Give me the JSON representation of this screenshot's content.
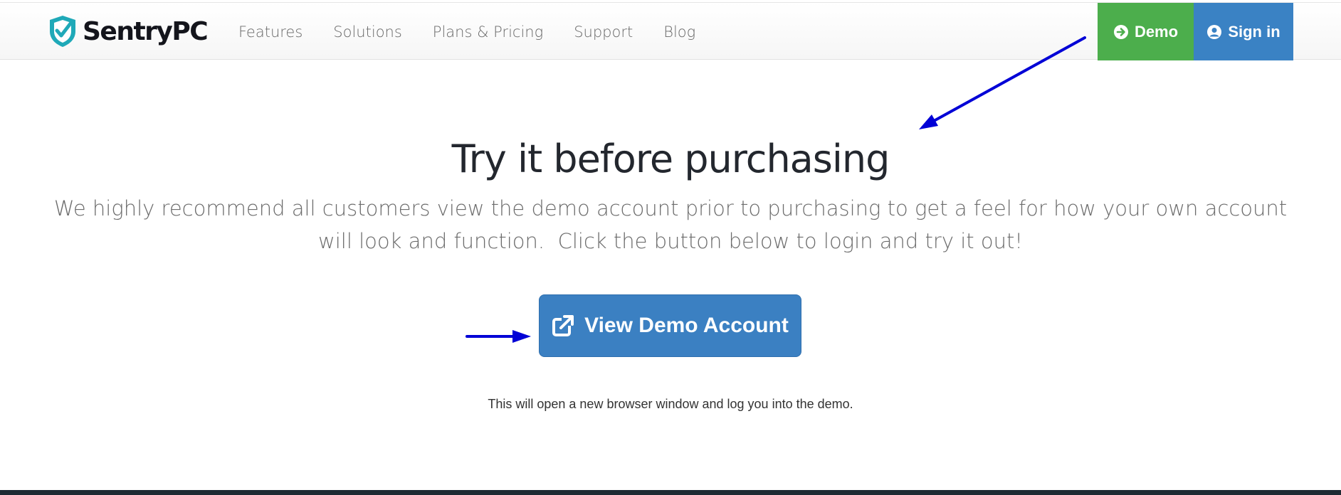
{
  "brand": {
    "name": "SentryPC",
    "accent": "#1fa9b8"
  },
  "nav": {
    "items": [
      {
        "label": "Features"
      },
      {
        "label": "Solutions"
      },
      {
        "label": "Plans & Pricing"
      },
      {
        "label": "Support"
      },
      {
        "label": "Blog"
      }
    ]
  },
  "header_actions": {
    "demo": {
      "label": "Demo",
      "icon": "arrow-right-circle-icon",
      "color": "#4cae4c"
    },
    "signin": {
      "label": "Sign in",
      "icon": "user-circle-icon",
      "color": "#3a82c4"
    }
  },
  "main": {
    "headline": "Try it before purchasing",
    "description": "We highly recommend all customers view the demo account prior to purchasing to get a feel for how your own account will look and function.  Click the button below to login and try it out!",
    "cta": {
      "label": "View Demo Account",
      "icon": "external-link-icon",
      "color": "#3b80c2"
    },
    "note": "This will open a new browser window and log you into the demo."
  },
  "annotations": {
    "arrow_color": "#0000d6"
  }
}
